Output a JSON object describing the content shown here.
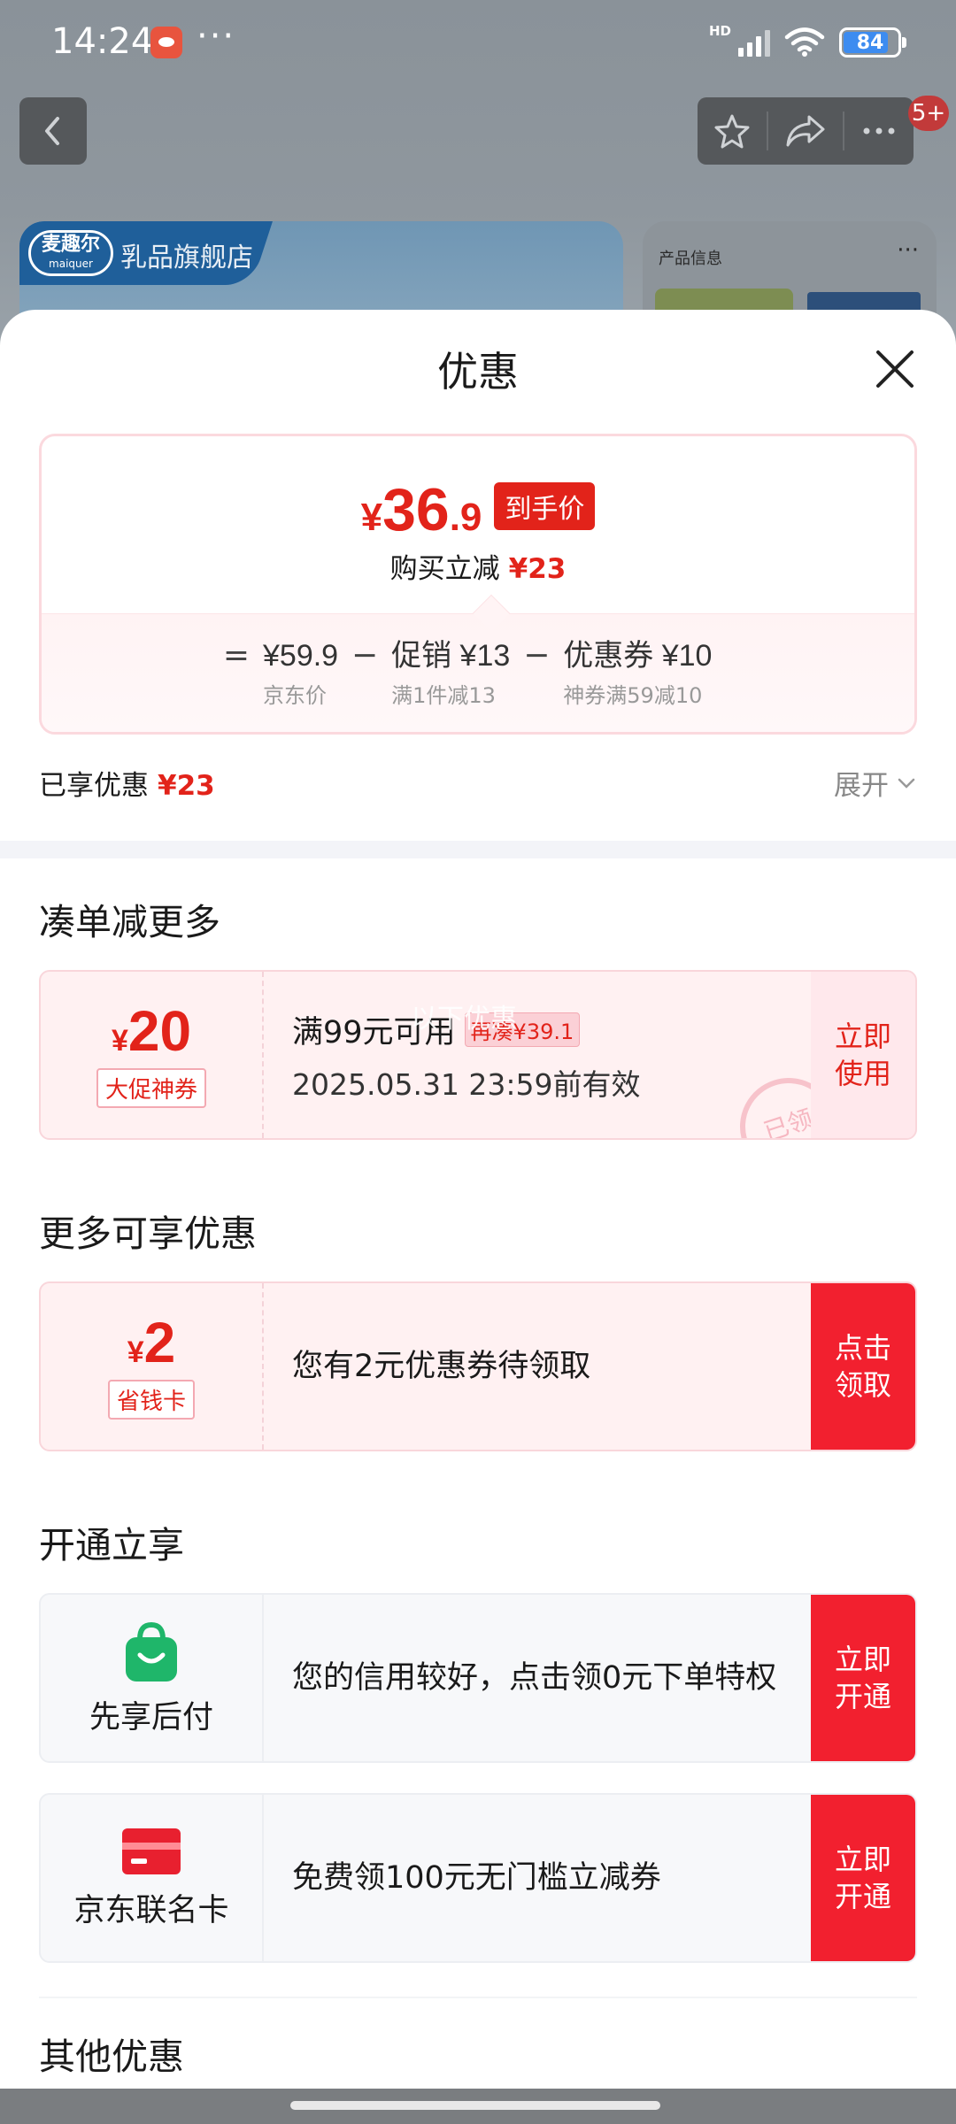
{
  "status_bar": {
    "time": "14:24",
    "network": "HD",
    "battery": "84"
  },
  "background": {
    "store_logo_cn": "麦趣尔",
    "store_logo_en": "maiquer",
    "store_name": "乳品旗舰店",
    "product_info_title": "产品信息",
    "product_info_more": "···",
    "badge": "5+"
  },
  "sheet": {
    "title": "优惠",
    "price": {
      "yen": "¥",
      "integer": "36",
      "decimal": ".9",
      "tag": "到手价",
      "reduce_label": "购买立减",
      "reduce_amount": "¥23"
    },
    "calc": {
      "equals": "=",
      "minus": "−",
      "items": [
        {
          "value": "¥59.9",
          "sub": "京东价"
        },
        {
          "value": "促销 ¥13",
          "sub": "满1件减13"
        },
        {
          "value": "优惠券 ¥10",
          "sub": "神券满59减10"
        }
      ]
    },
    "enjoyed_label": "已享优惠",
    "enjoyed_amount": "¥23",
    "expand_label": "展开"
  },
  "sections": {
    "more_combo": {
      "title": "凑单减更多",
      "coupon": {
        "yen": "¥",
        "amount": "20",
        "label": "大促神券",
        "condition": "满99元可用",
        "again_tag": "再凑¥39.1",
        "expiry": "2025.05.31 23:59前有效",
        "action": "立即使用",
        "stamp": "已领",
        "watermark": "以下优惠"
      }
    },
    "more_offers": {
      "title": "更多可享优惠",
      "coupon": {
        "yen": "¥",
        "amount": "2",
        "label": "省钱卡",
        "text": "您有2元优惠券待领取",
        "action": "点击领取"
      }
    },
    "open_enjoy": {
      "title": "开通立享",
      "items": [
        {
          "icon": "shopping-bag-icon",
          "name": "先享后付",
          "text": "您的信用较好，点击领0元下单特权",
          "action": "立即开通",
          "color": "#1fb66a"
        },
        {
          "icon": "card-icon",
          "name": "京东联名卡",
          "text": "免费领100元无门槛立减券",
          "action": "立即开通",
          "color": "#e8202f"
        }
      ]
    },
    "other": {
      "title": "其他优惠"
    }
  },
  "colors": {
    "accent": "#e2231a",
    "button_red": "#f2202f"
  }
}
